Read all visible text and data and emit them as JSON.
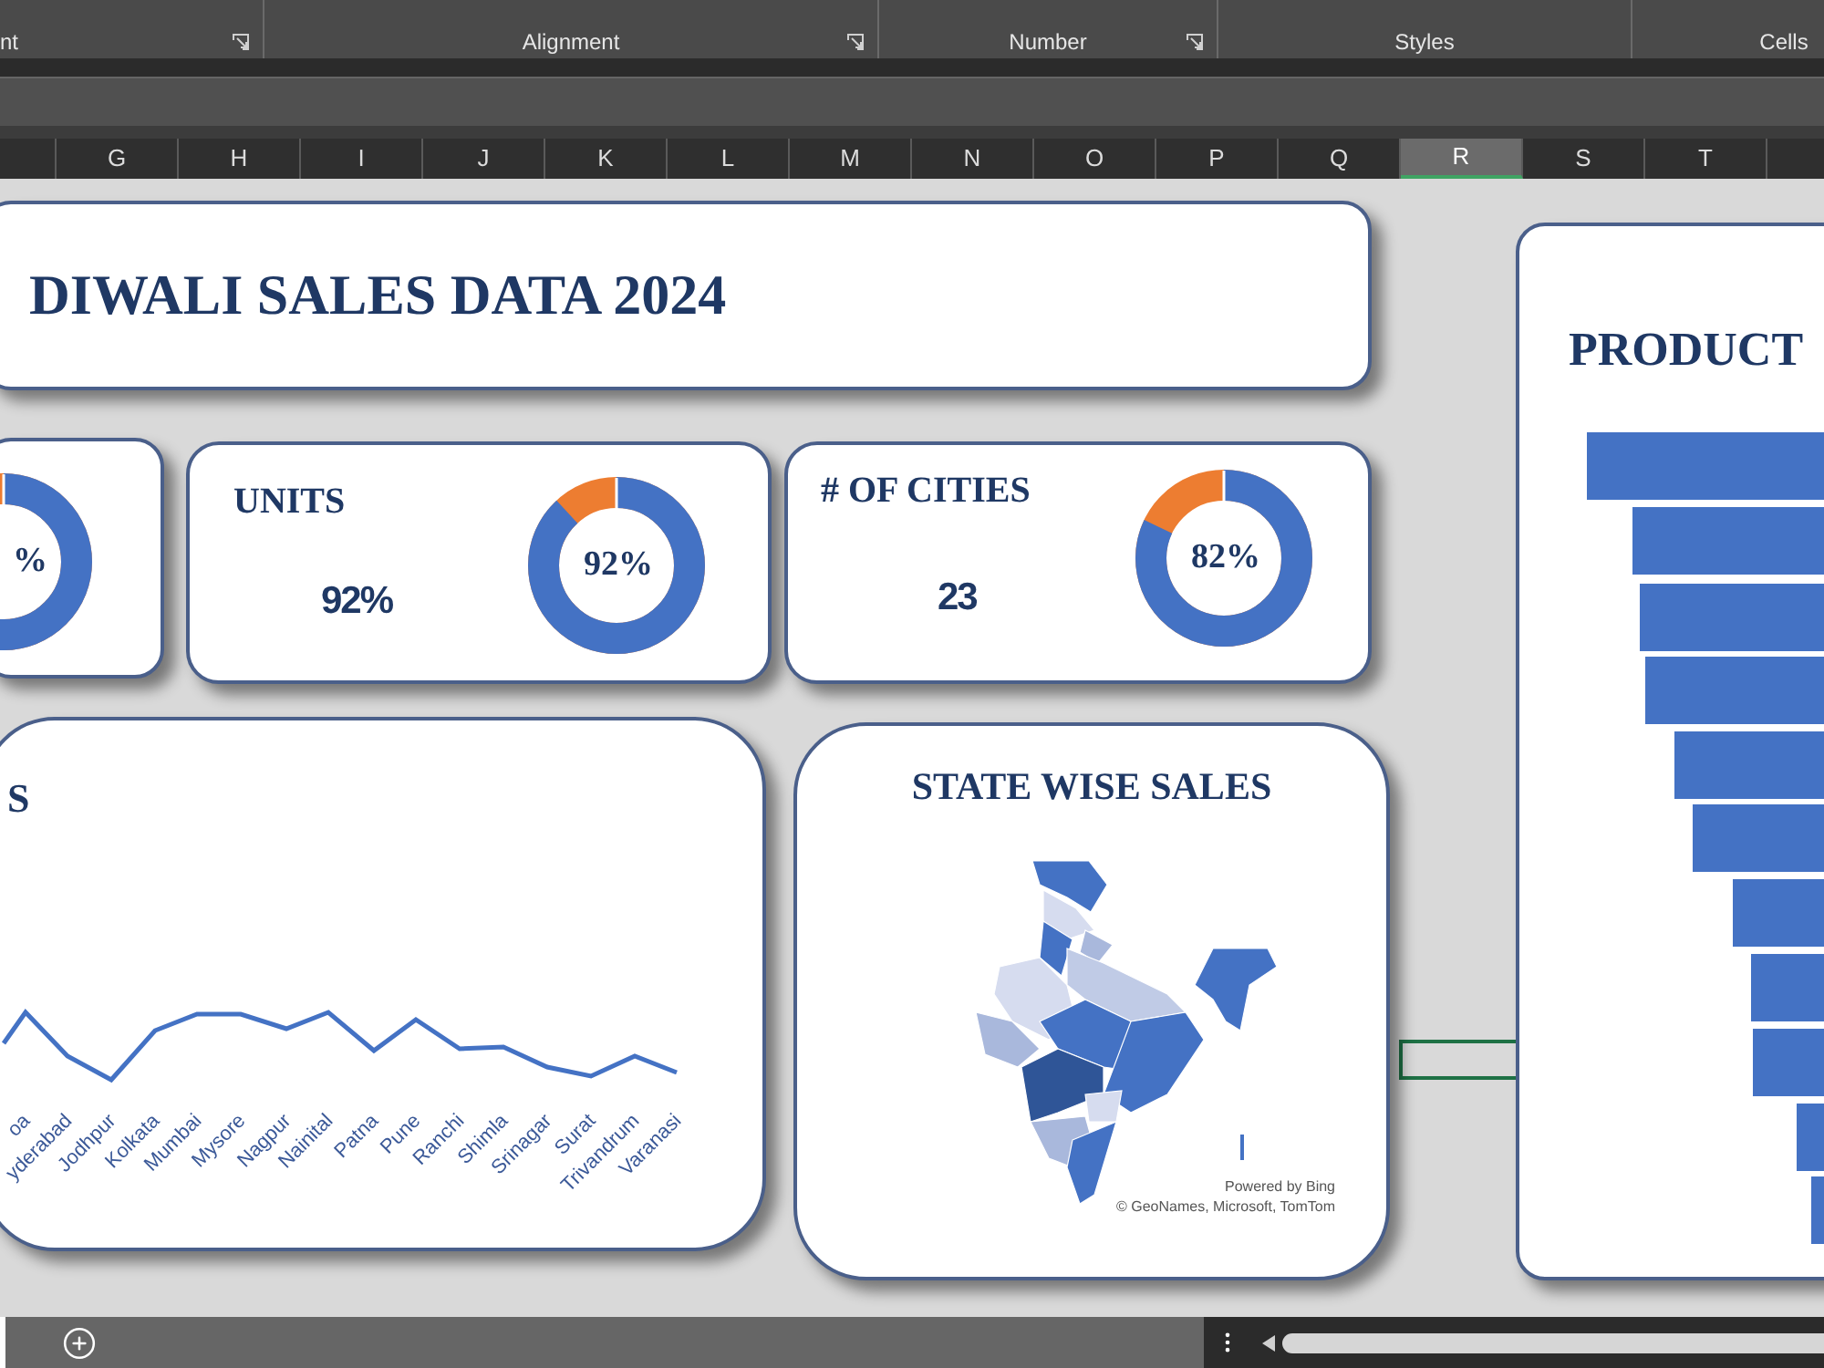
{
  "ribbon": {
    "groups": [
      {
        "label": "nt",
        "launcher": true
      },
      {
        "label": "Alignment",
        "launcher": true
      },
      {
        "label": "Number",
        "launcher": true
      },
      {
        "label": "Styles",
        "launcher": false
      },
      {
        "label": "Cells",
        "launcher": false
      }
    ]
  },
  "column_headers": [
    {
      "label": "G",
      "selected": false
    },
    {
      "label": "H",
      "selected": false
    },
    {
      "label": "I",
      "selected": false
    },
    {
      "label": "J",
      "selected": false
    },
    {
      "label": "K",
      "selected": false
    },
    {
      "label": "L",
      "selected": false
    },
    {
      "label": "M",
      "selected": false
    },
    {
      "label": "N",
      "selected": false
    },
    {
      "label": "O",
      "selected": false
    },
    {
      "label": "P",
      "selected": false
    },
    {
      "label": "Q",
      "selected": false
    },
    {
      "label": "R",
      "selected": true
    },
    {
      "label": "S",
      "selected": false
    },
    {
      "label": "T",
      "selected": false
    }
  ],
  "dashboard": {
    "title": "DIWALI SALES DATA 2024",
    "kpis": [
      {
        "donut_label": "%"
      },
      {
        "title": "UNITS",
        "value": "92%",
        "donut_label": "92%"
      },
      {
        "title": "# OF CITIES",
        "value": "23",
        "donut_label": "82%"
      }
    ],
    "city_chart": {
      "title": "S",
      "x_labels": [
        "oa",
        "yderabad",
        "Jodhpur",
        "Kolkata",
        "Mumbai",
        "Mysore",
        "Nagpur",
        "Nainital",
        "Patna",
        "Pune",
        "Ranchi",
        "Shimla",
        "Srinagar",
        "Surat",
        "Trivandrum",
        "Varanasi"
      ]
    },
    "state_map": {
      "title": "STATE WISE SALES",
      "credits": [
        "Powered by Bing",
        "© GeoNames, Microsoft, TomTom"
      ]
    },
    "product_chart": {
      "title": "PRODUCT"
    }
  }
}
